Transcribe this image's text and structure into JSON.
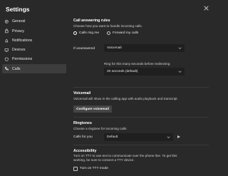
{
  "window": {
    "title": "Settings"
  },
  "sidebar": {
    "items": [
      {
        "label": "General",
        "icon": "gear-icon"
      },
      {
        "label": "Privacy",
        "icon": "lock-icon"
      },
      {
        "label": "Notifications",
        "icon": "bell-icon"
      },
      {
        "label": "Devices",
        "icon": "monitor-icon"
      },
      {
        "label": "Permissions",
        "icon": "shield-icon"
      },
      {
        "label": "Calls",
        "icon": "phone-icon",
        "active": true
      }
    ]
  },
  "call_answering": {
    "heading": "Call answering rules",
    "description": "Choose how you want to handle incoming calls.",
    "options": [
      {
        "label": "Calls ring me",
        "selected": true
      },
      {
        "label": "Forward my calls",
        "selected": false
      }
    ],
    "unanswered_label": "If unanswered",
    "unanswered_value": "Voicemail",
    "ring_label": "Ring for this many seconds before redirecting",
    "ring_value": "20 seconds (default)"
  },
  "voicemail": {
    "heading": "Voicemail",
    "description": "Voicemail will show in the calling app with audio playback and transcript.",
    "button_label": "Configure voicemail"
  },
  "ringtones": {
    "heading": "Ringtones",
    "description": "Choose a ringtone for incoming calls.",
    "calls_label": "Calls for you",
    "calls_value": "Default"
  },
  "accessibility": {
    "heading": "Accessibility",
    "description_line1": "Turn on TTY to use text to communicate over the phone line. To get this",
    "description_line2": "working, be sure to connect a TTY device.",
    "tty_label": "Turn on TTY mode",
    "tty_checked": false
  },
  "colors": {
    "background": "#292929",
    "field": "#1f1f1f",
    "button": "#454545",
    "active_nav": "#3d3d3d"
  }
}
